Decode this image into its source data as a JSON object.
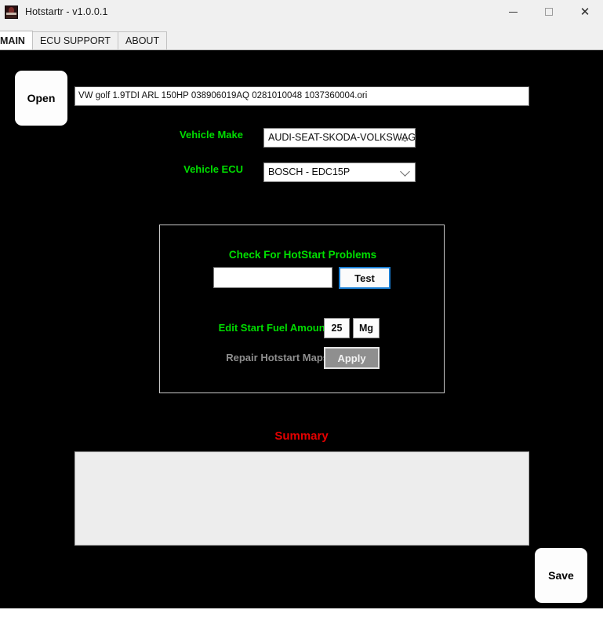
{
  "window": {
    "title": "Hotstartr - v1.0.0.1",
    "icon": "app-icon",
    "controls": {
      "minimize": "minimize-icon",
      "maximize": "maximize-icon",
      "close": "✕"
    }
  },
  "tabs": [
    {
      "label": "MAIN",
      "active": true
    },
    {
      "label": "ECU SUPPORT",
      "active": false
    },
    {
      "label": "ABOUT",
      "active": false
    }
  ],
  "main": {
    "open_button": "Open",
    "file_path": "VW golf 1.9TDI ARL 150HP 038906019AQ 0281010048 1037360004.ori",
    "file_path_placeholder": "",
    "vehicle_make": {
      "label": "Vehicle Make",
      "value": "AUDI-SEAT-SKODA-VOLKSWAGEN"
    },
    "vehicle_ecu": {
      "label": "Vehicle ECU",
      "value": "BOSCH - EDC15P"
    },
    "panel": {
      "title": "Check For HotStart Problems",
      "check_input_value": "",
      "check_input_placeholder": "",
      "test_button": "Test",
      "fuel_label": "Edit Start Fuel Amount",
      "fuel_value": "25",
      "fuel_unit": "Mg",
      "repair_label": "Repair Hotstart Maps",
      "apply_button": "Apply"
    },
    "summary": {
      "title": "Summary",
      "content": ""
    },
    "save_button": "Save"
  },
  "colors": {
    "accent_green": "#00dd00",
    "summary_red": "#e50000",
    "focus_blue": "#1b7fd4",
    "disabled_gray": "#8e8e8e",
    "canvas_black": "#000000"
  }
}
